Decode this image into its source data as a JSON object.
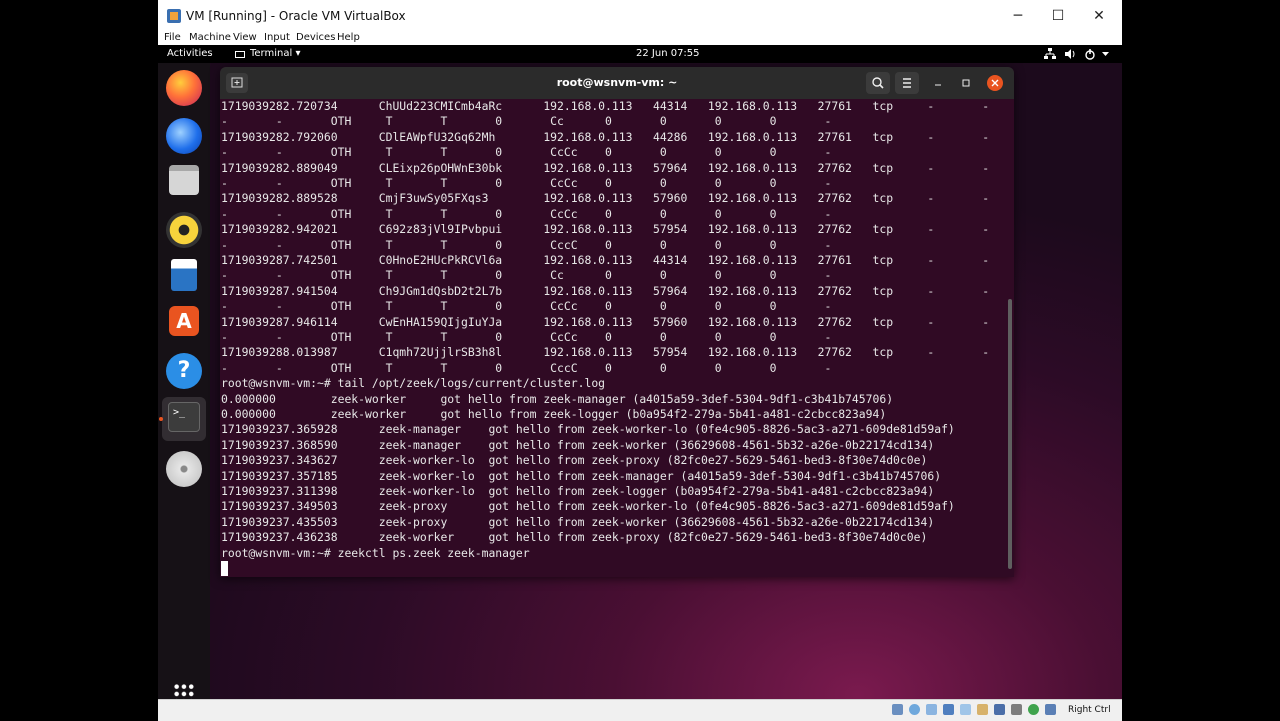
{
  "window": {
    "title": "VM [Running] - Oracle VM VirtualBox",
    "controls": {
      "minimize": "─",
      "maximize": "☐",
      "close": "✕"
    }
  },
  "menu": [
    {
      "label": "File"
    },
    {
      "label": "Machine"
    },
    {
      "label": "View"
    },
    {
      "label": "Input"
    },
    {
      "label": "Devices"
    },
    {
      "label": "Help"
    }
  ],
  "topbar": {
    "activities": "Activities",
    "app_menu": "Terminal ▾",
    "clock": "22 Jun  07:55",
    "tray_icons": [
      "network-icon",
      "volume-icon",
      "power-icon",
      "chevron-down-icon"
    ]
  },
  "dock": {
    "apps": [
      {
        "name": "firefox",
        "color": "#e66000"
      },
      {
        "name": "thunderbird",
        "color": "#0a84ff"
      },
      {
        "name": "files",
        "color": "#cfcfcf"
      },
      {
        "name": "rhythmbox",
        "color": "#f4c20d"
      },
      {
        "name": "libreoffice-writer",
        "color": "#2a74c4"
      },
      {
        "name": "software",
        "color": "#e95420"
      },
      {
        "name": "help",
        "color": "#2b8ee6"
      },
      {
        "name": "terminal",
        "color": "#3c3c3c"
      },
      {
        "name": "dvd",
        "color": "#d0d0d0"
      }
    ]
  },
  "terminal": {
    "title": "root@wsnvm-vm: ~",
    "lines": [
      "1719039282.720734      ChUUd223CMICmb4aRc      192.168.0.113   44314   192.168.0.113   27761   tcp     -       -",
      "-       -       OTH     T       T       0       Cc      0       0       0       0       -",
      "1719039282.792060      CDlEAWpfU32Gq62Mh       192.168.0.113   44286   192.168.0.113   27761   tcp     -       -",
      "-       -       OTH     T       T       0       CcCc    0       0       0       0       -",
      "1719039282.889049      CLEixp26pOHWnE30bk      192.168.0.113   57964   192.168.0.113   27762   tcp     -       -",
      "-       -       OTH     T       T       0       CcCc    0       0       0       0       -",
      "1719039282.889528      CmjF3uwSy05FXqs3        192.168.0.113   57960   192.168.0.113   27762   tcp     -       -",
      "-       -       OTH     T       T       0       CcCc    0       0       0       0       -",
      "1719039282.942021      C692z83jVl9IPvbpui      192.168.0.113   57954   192.168.0.113   27762   tcp     -       -",
      "-       -       OTH     T       T       0       CccC    0       0       0       0       -",
      "1719039287.742501      C0HnoE2HUcPkRCVl6a      192.168.0.113   44314   192.168.0.113   27761   tcp     -       -",
      "-       -       OTH     T       T       0       Cc      0       0       0       0       -",
      "1719039287.941504      Ch9JGm1dQsbD2t2L7b      192.168.0.113   57964   192.168.0.113   27762   tcp     -       -",
      "-       -       OTH     T       T       0       CcCc    0       0       0       0       -",
      "1719039287.946114      CwEnHA159QIjgIuYJa      192.168.0.113   57960   192.168.0.113   27762   tcp     -       -",
      "-       -       OTH     T       T       0       CcCc    0       0       0       0       -",
      "1719039288.013987      C1qmh72UjjlrSB3h8l      192.168.0.113   57954   192.168.0.113   27762   tcp     -       -",
      "-       -       OTH     T       T       0       CccC    0       0       0       0       -",
      "root@wsnvm-vm:~# tail /opt/zeek/logs/current/cluster.log",
      "0.000000        zeek-worker     got hello from zeek-manager (a4015a59-3def-5304-9df1-c3b41b745706)",
      "0.000000        zeek-worker     got hello from zeek-logger (b0a954f2-279a-5b41-a481-c2cbcc823a94)",
      "1719039237.365928      zeek-manager    got hello from zeek-worker-lo (0fe4c905-8826-5ac3-a271-609de81d59af)",
      "1719039237.368590      zeek-manager    got hello from zeek-worker (36629608-4561-5b32-a26e-0b22174cd134)",
      "1719039237.343627      zeek-worker-lo  got hello from zeek-proxy (82fc0e27-5629-5461-bed3-8f30e74d0c0e)",
      "1719039237.357185      zeek-worker-lo  got hello from zeek-manager (a4015a59-3def-5304-9df1-c3b41b745706)",
      "1719039237.311398      zeek-worker-lo  got hello from zeek-logger (b0a954f2-279a-5b41-a481-c2cbcc823a94)",
      "1719039237.349503      zeek-proxy      got hello from zeek-worker-lo (0fe4c905-8826-5ac3-a271-609de81d59af)",
      "1719039237.435503      zeek-proxy      got hello from zeek-worker (36629608-4561-5b32-a26e-0b22174cd134)",
      "1719039237.436238      zeek-worker     got hello from zeek-proxy (82fc0e27-5629-5461-bed3-8f30e74d0c0e)",
      "root@wsnvm-vm:~# zeekctl ps.zeek zeek-manager"
    ]
  },
  "statusbar": {
    "host_key": "Right Ctrl",
    "icons": [
      "hdd-icon",
      "optical-drive-icon",
      "audio-icon",
      "network-adapter-icon",
      "usb-icon",
      "shared-folder-icon",
      "display-icon",
      "recording-icon",
      "mouse-integration-icon",
      "keyboard-icon"
    ]
  }
}
